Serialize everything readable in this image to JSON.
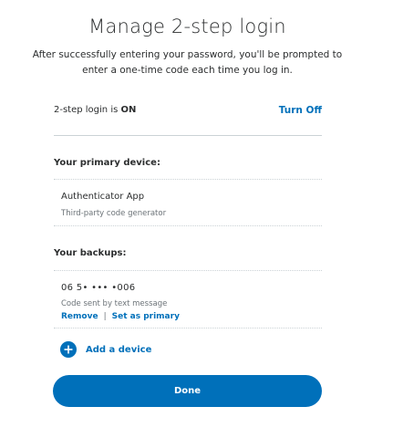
{
  "header": {
    "title": "Manage 2-step login",
    "description": "After successfully entering your password, you'll be prompted to enter a one-time code each time you log in."
  },
  "status": {
    "label_prefix": "2-step login is ",
    "state": "ON",
    "toggle_label": "Turn Off"
  },
  "primary": {
    "heading": "Your primary device:",
    "device_name": "Authenticator App",
    "device_description": "Third-party code generator"
  },
  "backups": {
    "heading": "Your backups:",
    "items": [
      {
        "number": "06 5• ••• •006",
        "description": "Code sent by text message",
        "remove_label": "Remove",
        "separator": "|",
        "set_primary_label": "Set as primary"
      }
    ]
  },
  "add_device": {
    "label": "Add a device",
    "icon": "plus-circle-icon"
  },
  "footer": {
    "done_label": "Done"
  },
  "colors": {
    "accent": "#0070ba",
    "text": "#2c2e2f",
    "muted": "#6c7378",
    "divider": "#cbd2d6"
  }
}
